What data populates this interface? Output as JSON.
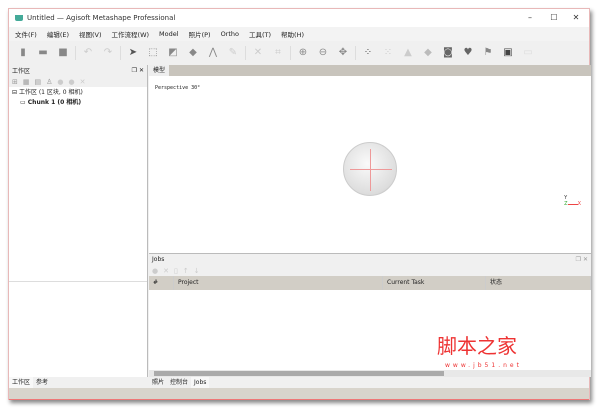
{
  "window": {
    "title": "Untitled — Agisoft Metashape Professional",
    "minimize": "–",
    "maximize": "☐",
    "close": "✕"
  },
  "menu": [
    "文件(F)",
    "编辑(E)",
    "视图(V)",
    "工作流程(W)",
    "Model",
    "照片(P)",
    "Ortho",
    "工具(T)",
    "帮助(H)"
  ],
  "workspace": {
    "title": "工作区",
    "root": "工作区 (1 区块, 0 相机)",
    "chunk": "Chunk 1 (0 相机)",
    "tabs": [
      "工作区",
      "参考"
    ]
  },
  "model": {
    "tab": "模型",
    "perspective": "Perspective 30°",
    "axis_labels": [
      "Y",
      "X",
      "Z"
    ]
  },
  "jobs": {
    "title": "Jobs",
    "columns": [
      "#",
      "Project",
      "Current Task",
      "状态"
    ],
    "tabs": [
      "照片",
      "控制台",
      "Jobs"
    ]
  },
  "watermark": {
    "title": "脚本之家",
    "url": "www.jb51.net"
  }
}
